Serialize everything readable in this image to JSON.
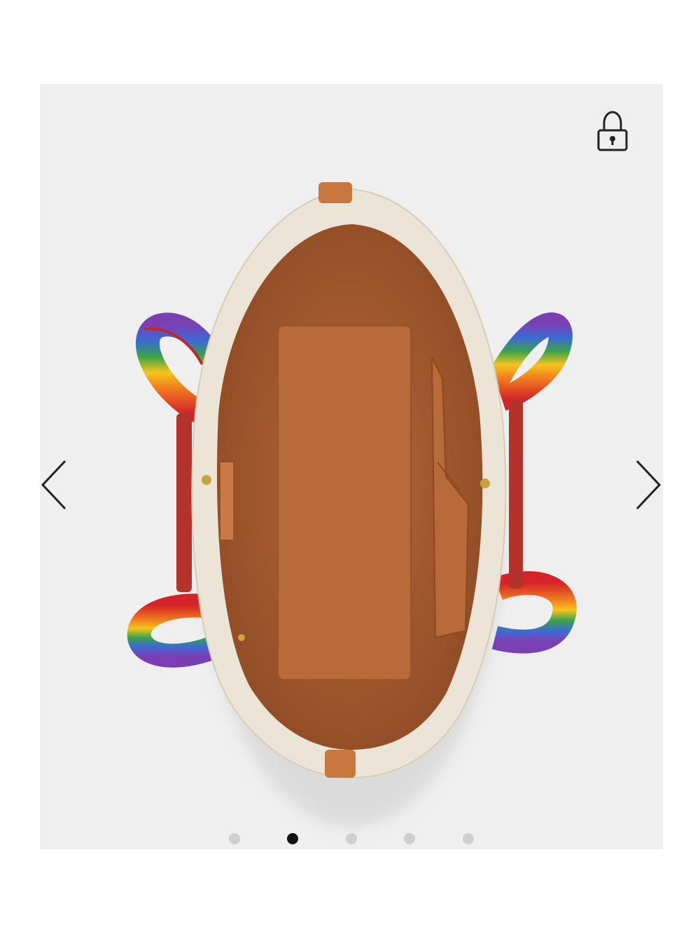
{
  "gallery": {
    "current_index": 2,
    "total_images": 5,
    "dots": [
      {
        "active": false
      },
      {
        "active": true
      },
      {
        "active": false
      },
      {
        "active": false
      },
      {
        "active": false
      }
    ],
    "colors": {
      "background": "#efefef",
      "dot_active": "#111111",
      "dot_inactive": "#cfcfcf",
      "arrow": "#222222",
      "lining": "#b5673a",
      "canvas_trim": "#ece4d6",
      "leather_tab": "#c8783f",
      "rainbow": [
        "#d4242a",
        "#f07b1e",
        "#f5c51c",
        "#3aa24a",
        "#3a6bd4",
        "#7b3fb4"
      ]
    },
    "icons": {
      "prev": "chevron-left-icon",
      "next": "chevron-right-icon",
      "lock": "lock-icon"
    }
  }
}
